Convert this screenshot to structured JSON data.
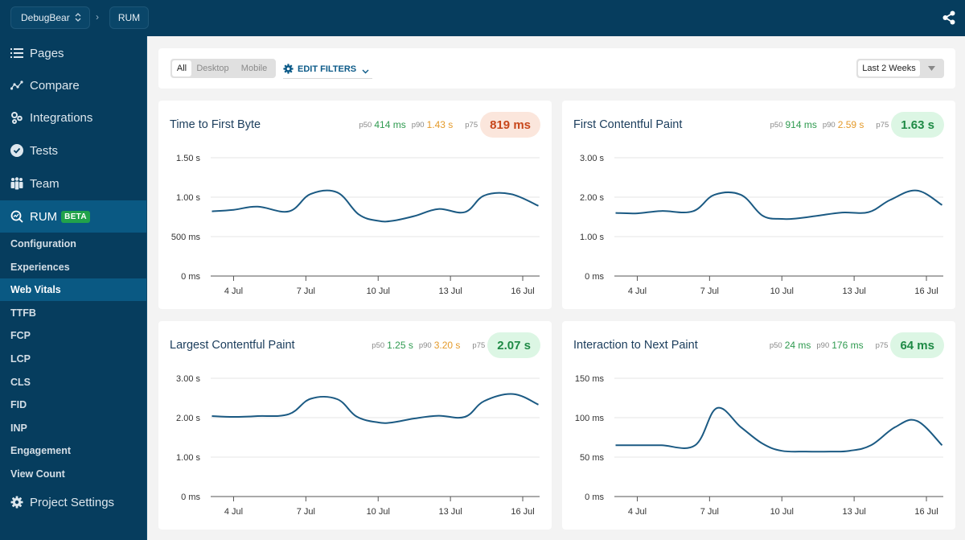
{
  "topbar": {
    "project": "DebugBear",
    "breadcrumb_sep": "›",
    "section": "RUM",
    "share_icon": "share-icon"
  },
  "sidebar": {
    "items": [
      {
        "label": "Pages",
        "icon": "list-icon"
      },
      {
        "label": "Compare",
        "icon": "compare-icon"
      },
      {
        "label": "Integrations",
        "icon": "integrations-icon"
      },
      {
        "label": "Tests",
        "icon": "check-circle-icon"
      },
      {
        "label": "Team",
        "icon": "team-icon"
      },
      {
        "label": "RUM",
        "icon": "rum-icon",
        "badge": "BETA",
        "active": true
      }
    ],
    "sub_items": [
      {
        "label": "Configuration"
      },
      {
        "label": "Experiences"
      },
      {
        "label": "Web Vitals",
        "active": true
      },
      {
        "label": "TTFB"
      },
      {
        "label": "FCP"
      },
      {
        "label": "LCP"
      },
      {
        "label": "CLS"
      },
      {
        "label": "FID"
      },
      {
        "label": "INP"
      },
      {
        "label": "Engagement"
      },
      {
        "label": "View Count"
      }
    ],
    "settings": {
      "label": "Project Settings",
      "icon": "gear-icon"
    }
  },
  "filters": {
    "device_tabs": [
      {
        "label": "All",
        "selected": true
      },
      {
        "label": "Desktop",
        "selected": false
      },
      {
        "label": "Mobile",
        "selected": false
      }
    ],
    "edit_filters_label": "EDIT FILTERS",
    "date_range": "Last 2 Weeks"
  },
  "colors": {
    "nav_bg": "#063d5e",
    "nav_active": "#0a5983",
    "line": "#1b5a83",
    "good": "#2e9a4f",
    "warn": "#e49a2a",
    "bad": "#d9531e"
  },
  "cards": [
    {
      "title": "Time to First Byte",
      "p50_label": "p50",
      "p50": "414 ms",
      "p50_status": "good",
      "p90_label": "p90",
      "p90": "1.43 s",
      "p90_status": "warn",
      "p75_label": "p75",
      "p75": "819 ms",
      "p75_status": "bad"
    },
    {
      "title": "First Contentful Paint",
      "p50_label": "p50",
      "p50": "914 ms",
      "p50_status": "good",
      "p90_label": "p90",
      "p90": "2.59 s",
      "p90_status": "warn",
      "p75_label": "p75",
      "p75": "1.63 s",
      "p75_status": "good"
    },
    {
      "title": "Largest Contentful Paint",
      "p50_label": "p50",
      "p50": "1.25 s",
      "p50_status": "good",
      "p90_label": "p90",
      "p90": "3.20 s",
      "p90_status": "warn",
      "p75_label": "p75",
      "p75": "2.07 s",
      "p75_status": "good"
    },
    {
      "title": "Interaction to Next Paint",
      "p50_label": "p50",
      "p50": "24 ms",
      "p50_status": "good",
      "p90_label": "p90",
      "p90": "176 ms",
      "p90_status": "good",
      "p75_label": "p75",
      "p75": "64 ms",
      "p75_status": "good"
    }
  ],
  "chart_data": [
    {
      "type": "line",
      "title": "Time to First Byte",
      "xlabel": "",
      "ylabel": "",
      "unit": "s",
      "xlim": [
        3.05,
        16.7
      ],
      "ylim": [
        0,
        1.5
      ],
      "grid": true,
      "yticks": [
        0,
        0.5,
        1.0,
        1.5
      ],
      "ytick_labels": [
        "0 ms",
        "500 ms",
        "1.00 s",
        "1.50 s"
      ],
      "xticks": [
        4,
        7,
        10,
        13,
        16
      ],
      "xtick_labels": [
        "4 Jul",
        "7 Jul",
        "10 Jul",
        "13 Jul",
        "16 Jul"
      ],
      "series": [
        {
          "name": "p75",
          "x": [
            3.1,
            4,
            5,
            6.3,
            7.2,
            8.3,
            9.2,
            10,
            10.6,
            11.5,
            12.5,
            13.6,
            14.4,
            15.5,
            16.65
          ],
          "values": [
            0.82,
            0.84,
            0.88,
            0.82,
            1.04,
            1.06,
            0.78,
            0.7,
            0.7,
            0.76,
            0.85,
            0.81,
            1.02,
            1.04,
            0.89
          ]
        }
      ]
    },
    {
      "type": "line",
      "title": "First Contentful Paint",
      "xlabel": "",
      "ylabel": "",
      "unit": "s",
      "xlim": [
        3.05,
        16.7
      ],
      "ylim": [
        0,
        3.0
      ],
      "grid": true,
      "yticks": [
        0,
        1.0,
        2.0,
        3.0
      ],
      "ytick_labels": [
        "0 ms",
        "1.00 s",
        "2.00 s",
        "3.00 s"
      ],
      "xticks": [
        4,
        7,
        10,
        13,
        16
      ],
      "xtick_labels": [
        "4 Jul",
        "7 Jul",
        "10 Jul",
        "13 Jul",
        "16 Jul"
      ],
      "series": [
        {
          "name": "p75",
          "x": [
            3.1,
            4,
            5,
            6.3,
            7.2,
            8.3,
            9.2,
            10,
            10.6,
            11.5,
            12.5,
            13.6,
            14.5,
            15.6,
            16.65
          ],
          "values": [
            1.6,
            1.59,
            1.65,
            1.64,
            2.06,
            2.06,
            1.53,
            1.45,
            1.46,
            1.53,
            1.61,
            1.62,
            1.93,
            2.17,
            1.8
          ]
        }
      ]
    },
    {
      "type": "line",
      "title": "Largest Contentful Paint",
      "xlabel": "",
      "ylabel": "",
      "unit": "s",
      "xlim": [
        3.05,
        16.7
      ],
      "ylim": [
        0,
        3.0
      ],
      "grid": true,
      "yticks": [
        0,
        1.0,
        2.0,
        3.0
      ],
      "ytick_labels": [
        "0 ms",
        "1.00 s",
        "2.00 s",
        "3.00 s"
      ],
      "xticks": [
        4,
        7,
        10,
        13,
        16
      ],
      "xtick_labels": [
        "4 Jul",
        "7 Jul",
        "10 Jul",
        "13 Jul",
        "16 Jul"
      ],
      "series": [
        {
          "name": "p75",
          "x": [
            3.1,
            4,
            5,
            6.3,
            7.2,
            8.3,
            9.1,
            10,
            10.6,
            11.5,
            12.5,
            13.6,
            14.4,
            15.6,
            16.65
          ],
          "values": [
            2.04,
            2.02,
            2.04,
            2.09,
            2.48,
            2.47,
            2.03,
            1.88,
            1.88,
            1.98,
            2.05,
            2.02,
            2.42,
            2.6,
            2.33
          ]
        }
      ]
    },
    {
      "type": "line",
      "title": "Interaction to Next Paint",
      "xlabel": "",
      "ylabel": "",
      "unit": "ms",
      "xlim": [
        3.05,
        16.7
      ],
      "ylim": [
        0,
        150
      ],
      "grid": true,
      "yticks": [
        0,
        50,
        100,
        150
      ],
      "ytick_labels": [
        "0 ms",
        "50 ms",
        "100 ms",
        "150 ms"
      ],
      "xticks": [
        4,
        7,
        10,
        13,
        16
      ],
      "xtick_labels": [
        "4 Jul",
        "7 Jul",
        "10 Jul",
        "13 Jul",
        "16 Jul"
      ],
      "series": [
        {
          "name": "p75",
          "x": [
            3.1,
            4,
            5,
            6.4,
            7.3,
            8.3,
            9.2,
            10,
            11,
            12,
            12.8,
            13.7,
            14.7,
            15.6,
            16.65
          ],
          "values": [
            65,
            65,
            65,
            65,
            112,
            88,
            67,
            58,
            57,
            57,
            58,
            65,
            88,
            96,
            65
          ]
        }
      ]
    }
  ]
}
